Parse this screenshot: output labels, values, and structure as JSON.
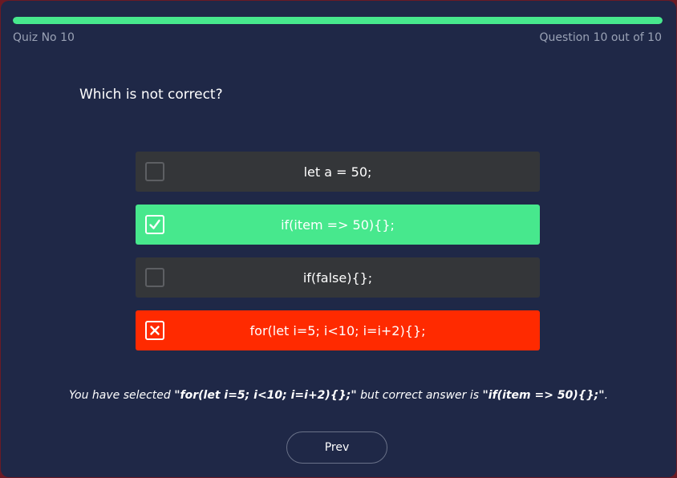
{
  "header": {
    "quiz_label": "Quiz No 10",
    "question_counter": "Question 10 out of 10",
    "progress": 1.0
  },
  "question": "Which is not correct?",
  "options": [
    {
      "label": "let a = 50;",
      "state": "unchecked"
    },
    {
      "label": "if(item => 50){};",
      "state": "correct-checked"
    },
    {
      "label": "if(false){};",
      "state": "unchecked"
    },
    {
      "label": "for(let i=5; i<10; i=i+2){};",
      "state": "wrong-crossed"
    }
  ],
  "feedback": {
    "prefix": "You have selected ",
    "selected": "\"for(let i=5; i<10; i=i+2){};\"",
    "middle": " but correct answer is ",
    "correct": "\"if(item => 50){};\"",
    "suffix": "."
  },
  "nav": {
    "prev_label": "Prev"
  },
  "colors": {
    "background": "#1f2847",
    "accent_green": "#47e88d",
    "wrong_red": "#ff2a00",
    "option_default": "#343639"
  },
  "icons": {
    "correct": "check-icon",
    "wrong": "cross-icon"
  }
}
